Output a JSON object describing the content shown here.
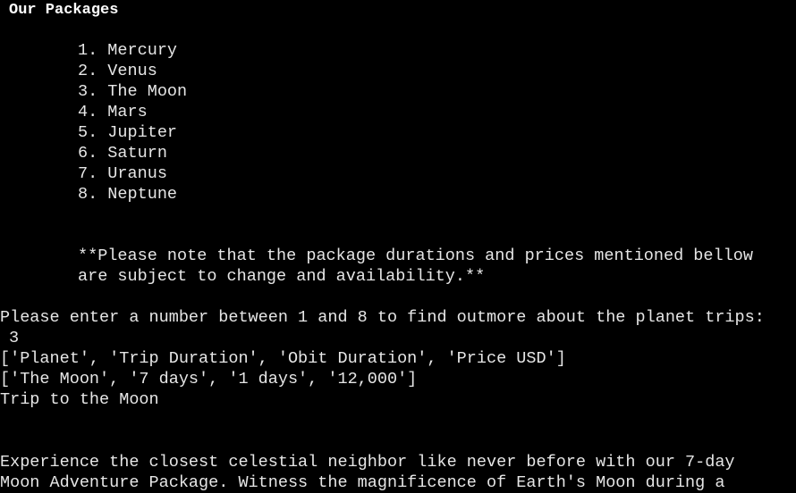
{
  "terminal": {
    "heading": "Our Packages",
    "packages": [
      "1. Mercury",
      "2. Venus",
      "3. The Moon",
      "4. Mars",
      "5. Jupiter",
      "6. Saturn",
      "7. Uranus",
      "8. Neptune"
    ],
    "note_line1": "**Please note that the package durations and prices mentioned bellow",
    "note_line2": "are subject to change and availability.**",
    "prompt": "Please enter a number between 1 and 8 to find outmore about the planet trips:",
    "user_input": "3",
    "table_header": "['Planet', 'Trip Duration', 'Obit Duration', 'Price USD']",
    "table_row": "['The Moon', '7 days', '1 days', '12,000']",
    "trip_title": "Trip to the Moon",
    "description_line1": "Experience the closest celestial neighbor like never before with our 7-day",
    "description_line2": "Moon Adventure Package. Witness the magnificence of Earth's Moon during a"
  }
}
